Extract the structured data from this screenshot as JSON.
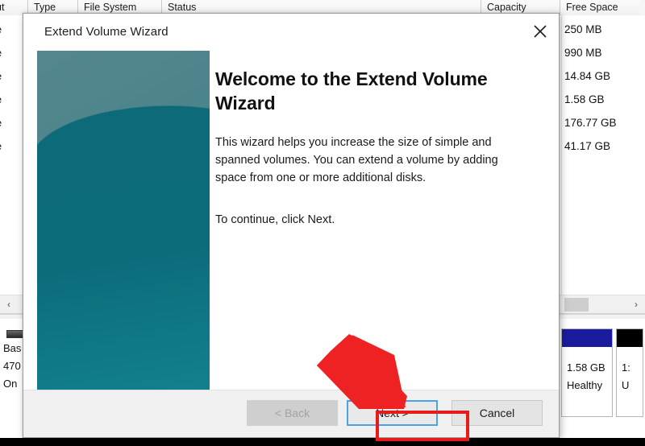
{
  "background_window": {
    "name": "Disk Management volume list",
    "columns": [
      "ut",
      "Type",
      "File System",
      "Status",
      "Capacity",
      "Free Space"
    ],
    "rows": [
      {
        "layout": "le",
        "free_space": "250 MB"
      },
      {
        "layout": "le",
        "free_space": "990 MB"
      },
      {
        "layout": "le",
        "free_space": "14.84 GB"
      },
      {
        "layout": "le",
        "free_space": "1.58 GB"
      },
      {
        "layout": "le",
        "free_space": "176.77 GB"
      },
      {
        "layout": "le",
        "free_space": "41.17 GB"
      }
    ],
    "scrollbar": {
      "left_arrow": "‹",
      "right_arrow": "›"
    },
    "disk_graphic": {
      "disk_label_lines": [
        "Bas",
        "470",
        "On"
      ],
      "volumes": [
        {
          "capacity": "1.58 GB",
          "status": "Healthy",
          "bar_color": "#1b1b9e"
        },
        {
          "capacity": "1:",
          "status": "U",
          "bar_color": "#000000"
        }
      ]
    }
  },
  "dialog": {
    "title": "Extend Volume Wizard",
    "close_label": "Close",
    "heading": "Welcome to the Extend Volume Wizard",
    "paragraph_1": "This wizard helps you increase the size of simple and spanned volumes. You can extend a volume  by adding space from one or more additional disks.",
    "paragraph_2": "To continue, click Next.",
    "buttons": {
      "back": "< Back",
      "next": "Next >",
      "cancel": "Cancel"
    }
  },
  "annotation": {
    "arrow_color": "#ee2222",
    "highlight_color": "#e81b1b",
    "focus_color": "#4aa3e8",
    "target": "Next >"
  },
  "theme": {
    "banner_top": "#49818a",
    "banner_bottom": "#0b6878",
    "dialog_bg": "#ffffff",
    "footer_bg": "#f0f0f0"
  }
}
